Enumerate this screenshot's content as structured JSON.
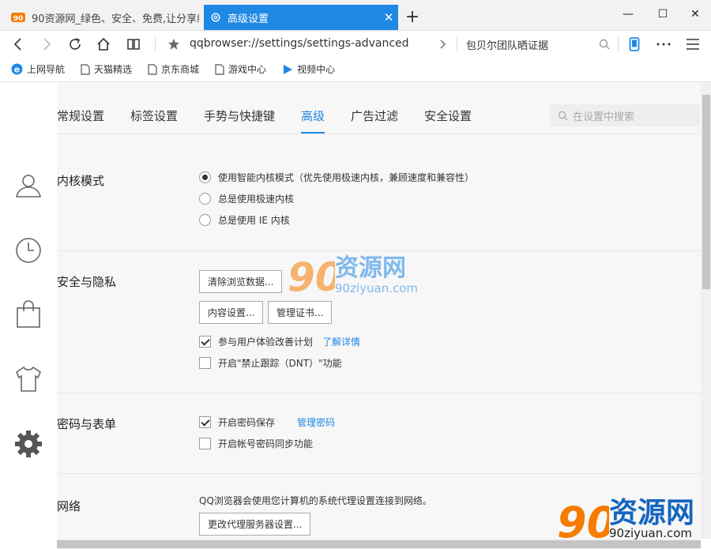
{
  "browser": {
    "tabs": [
      {
        "title": "90资源网_绿色、安全、免费,让分享继",
        "active": false
      },
      {
        "title": "高级设置",
        "active": true
      }
    ],
    "address": "qqbrowser://settings/settings-advanced",
    "search_suggestion": "包贝尔团队晒证据",
    "bookmarks": [
      "上网导航",
      "天猫精选",
      "京东商城",
      "游戏中心",
      "视频中心"
    ]
  },
  "settings": {
    "tabs": [
      "常规设置",
      "标签设置",
      "手势与快捷键",
      "高级",
      "广告过滤",
      "安全设置"
    ],
    "active_tab": "高级",
    "search_placeholder": "在设置中搜索",
    "kernel": {
      "title": "内核模式",
      "options": [
        "使用智能内核模式（优先使用极速内核，兼顾速度和兼容性）",
        "总是使用极速内核",
        "总是使用 IE 内核"
      ],
      "selected": 0
    },
    "privacy": {
      "title": "安全与隐私",
      "clear_button": "清除浏览数据...",
      "content_button": "内容设置...",
      "cert_button": "管理证书...",
      "ux_plan": "参与用户体验改善计划",
      "ux_plan_checked": true,
      "ux_link": "了解详情",
      "dnt": "开启\"禁止跟踪（DNT）\"功能",
      "dnt_checked": false
    },
    "password": {
      "title": "密码与表单",
      "save_pwd": "开启密码保存",
      "save_pwd_checked": true,
      "manage_link": "管理密码",
      "sync_pwd": "开启帐号密码同步功能",
      "sync_pwd_checked": false
    },
    "network": {
      "title": "网络",
      "desc": "QQ浏览器会使用您计算机的系统代理设置连接到网络。",
      "proxy_button": "更改代理服务器设置..."
    }
  },
  "watermark": {
    "name": "资源网",
    "domain": "90ziyuan.com"
  }
}
